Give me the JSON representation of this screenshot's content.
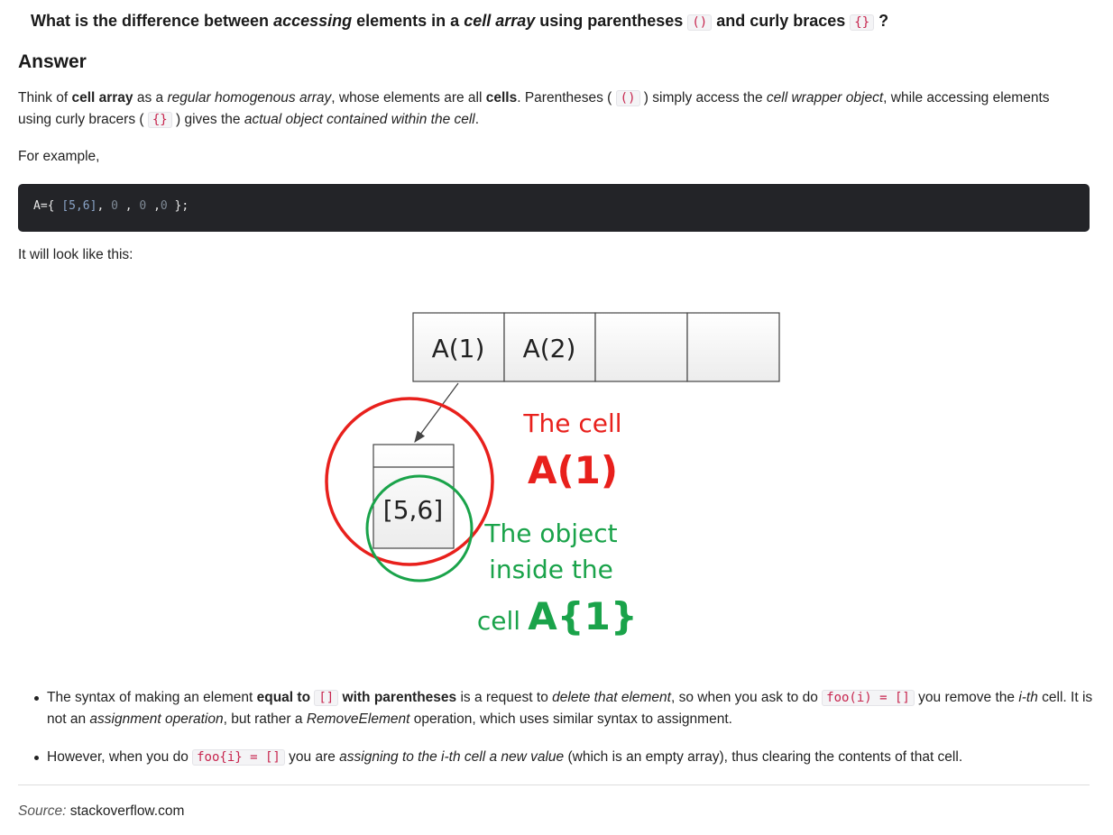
{
  "question": {
    "p1": "What is the difference between ",
    "em1": "accessing",
    "p2": " elements in a ",
    "em2": "cell array",
    "p3": " using parentheses ",
    "code1": "()",
    "p4": " and curly braces ",
    "code2": "{}",
    "p5": " ?"
  },
  "answer_heading": "Answer",
  "para1": {
    "t1": "Think of ",
    "b1": "cell array",
    "t2": " as a ",
    "i1": "regular homogenous array",
    "t3": ", whose elements are all ",
    "b2": "cells",
    "t4": ". Parentheses ( ",
    "c1": "()",
    "t5": " ) simply access the ",
    "i2": "cell wrapper object",
    "t6": ", while accessing elements using curly bracers ( ",
    "c2": "{}",
    "t7": " ) gives the ",
    "i3": "actual object contained within the cell",
    "t8": "."
  },
  "for_example": "For example,",
  "code": {
    "a": "A={ ",
    "b": "[5,6]",
    "c": ", ",
    "d": "0",
    "e": " , ",
    "f": "0",
    "g": " ,",
    "h": "0",
    "i": " };"
  },
  "look_like": "It will look like this:",
  "diagram": {
    "cell1": "A(1)",
    "cell2": "A(2)",
    "inner": "[5,6]",
    "red_label_1": "The cell",
    "red_label_2": "A(1)",
    "green_label_1": "The object",
    "green_label_2": "inside the",
    "green_label_3": "cell",
    "green_label_4": "A{1}",
    "red_color": "#e8201c",
    "green_color": "#1aa34a"
  },
  "bullet1": {
    "t1": "The syntax of making an element ",
    "b1": "equal to ",
    "c1": "[]",
    "b2": " with parentheses",
    "t2": " is a request to ",
    "i1": "delete that element",
    "t3": ", so when you ask to do ",
    "c2": "foo(i) = []",
    "t4": " you remove the ",
    "i2": "i-th",
    "t5": " cell. It is not an ",
    "i3": "assignment operation",
    "t6": ", but rather a ",
    "i4": "RemoveElement",
    "t7": " operation, which uses similar syntax to assignment."
  },
  "bullet2": {
    "t1": "However, when you do ",
    "c1": "foo{i} = []",
    "t2": " you are ",
    "i1": "assigning to the i-th cell a new value",
    "t3": " (which is an empty array), thus clearing the contents of that cell."
  },
  "source": {
    "label": "Source:",
    "site": "stackoverflow.com"
  }
}
